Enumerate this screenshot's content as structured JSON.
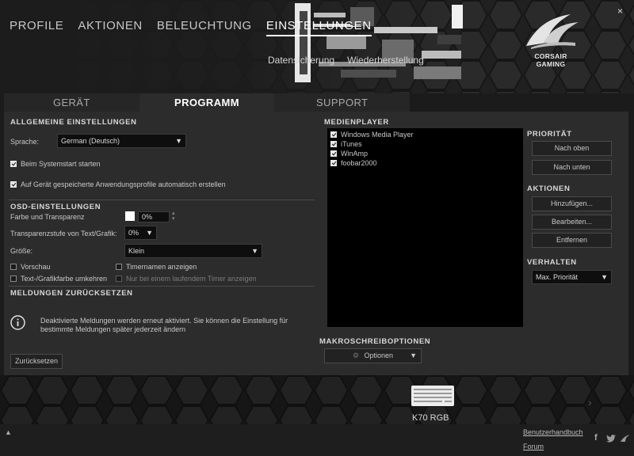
{
  "nav": {
    "items": [
      "PROFILE",
      "AKTIONEN",
      "BELEUCHTUNG",
      "EINSTELLUNGEN"
    ],
    "active_index": 3
  },
  "subnav": {
    "items": [
      "Datensicherung",
      "Wiederherstellung"
    ]
  },
  "window": {
    "close_icon": "×"
  },
  "brand": {
    "line1": "CORSAIR",
    "line2": "GAMING"
  },
  "tabs": {
    "items": [
      "GERÄT",
      "PROGRAMM",
      "SUPPORT"
    ],
    "active_index": 1
  },
  "general": {
    "title": "ALLGEMEINE EINSTELLUNGEN",
    "language_label": "Sprache:",
    "language_value": "German (Deutsch)",
    "startup_label": "Beim Systemstart starten",
    "startup_checked": true,
    "autocreate_label": "Auf Gerät gespeicherte Anwendungsprofile automatisch erstellen",
    "autocreate_checked": true
  },
  "osd": {
    "title": "OSD-EINSTELLUNGEN",
    "color_label": "Farbe und Transparenz",
    "color_value": "0%",
    "color_swatch": "#ffffff",
    "text_transparency_label": "Transparenzstufe von Text/Grafik:",
    "text_transparency_value": "0%",
    "size_label": "Größe:",
    "size_value": "Klein",
    "preview_label": "Vorschau",
    "timer_names_label": "Timernamen anzeigen",
    "invert_label": "Text-/Grafikfarbe umkehren",
    "only_running_label": "Nur bei einem laufendem Timer anzeigen"
  },
  "reset": {
    "title": "MELDUNGEN ZURÜCKSETZEN",
    "message_line1": "Deaktivierte Meldungen werden erneut aktiviert. Sie können die Einstellung für",
    "message_line2": "bestimmte Meldungen später jederzeit ändern",
    "button_label": "Zurücksetzen"
  },
  "media": {
    "title": "MEDIENPLAYER",
    "players": [
      {
        "name": "Windows Media Player",
        "checked": true
      },
      {
        "name": "iTunes",
        "checked": true
      },
      {
        "name": "WinAmp",
        "checked": true
      },
      {
        "name": "foobar2000",
        "checked": true
      }
    ]
  },
  "priority": {
    "title": "PRIORITÄT",
    "up_label": "Nach oben",
    "down_label": "Nach unten"
  },
  "actions": {
    "title": "AKTIONEN",
    "add_label": "Hinzufügen...",
    "edit_label": "Bearbeiten...",
    "remove_label": "Entfernen"
  },
  "behavior": {
    "title": "VERHALTEN",
    "value": "Max. Priorität"
  },
  "macro": {
    "title": "MAKROSCHREIBOPTIONEN",
    "options_label": "Optionen"
  },
  "device": {
    "name": "K70 RGB"
  },
  "footer": {
    "manual_label": "Benutzerhandbuch",
    "forum_label": "Forum",
    "facebook_icon": "f"
  },
  "colors": {
    "accent": "#ffffff",
    "background": "#1b1b1b",
    "panel": "#2c2c2c"
  }
}
